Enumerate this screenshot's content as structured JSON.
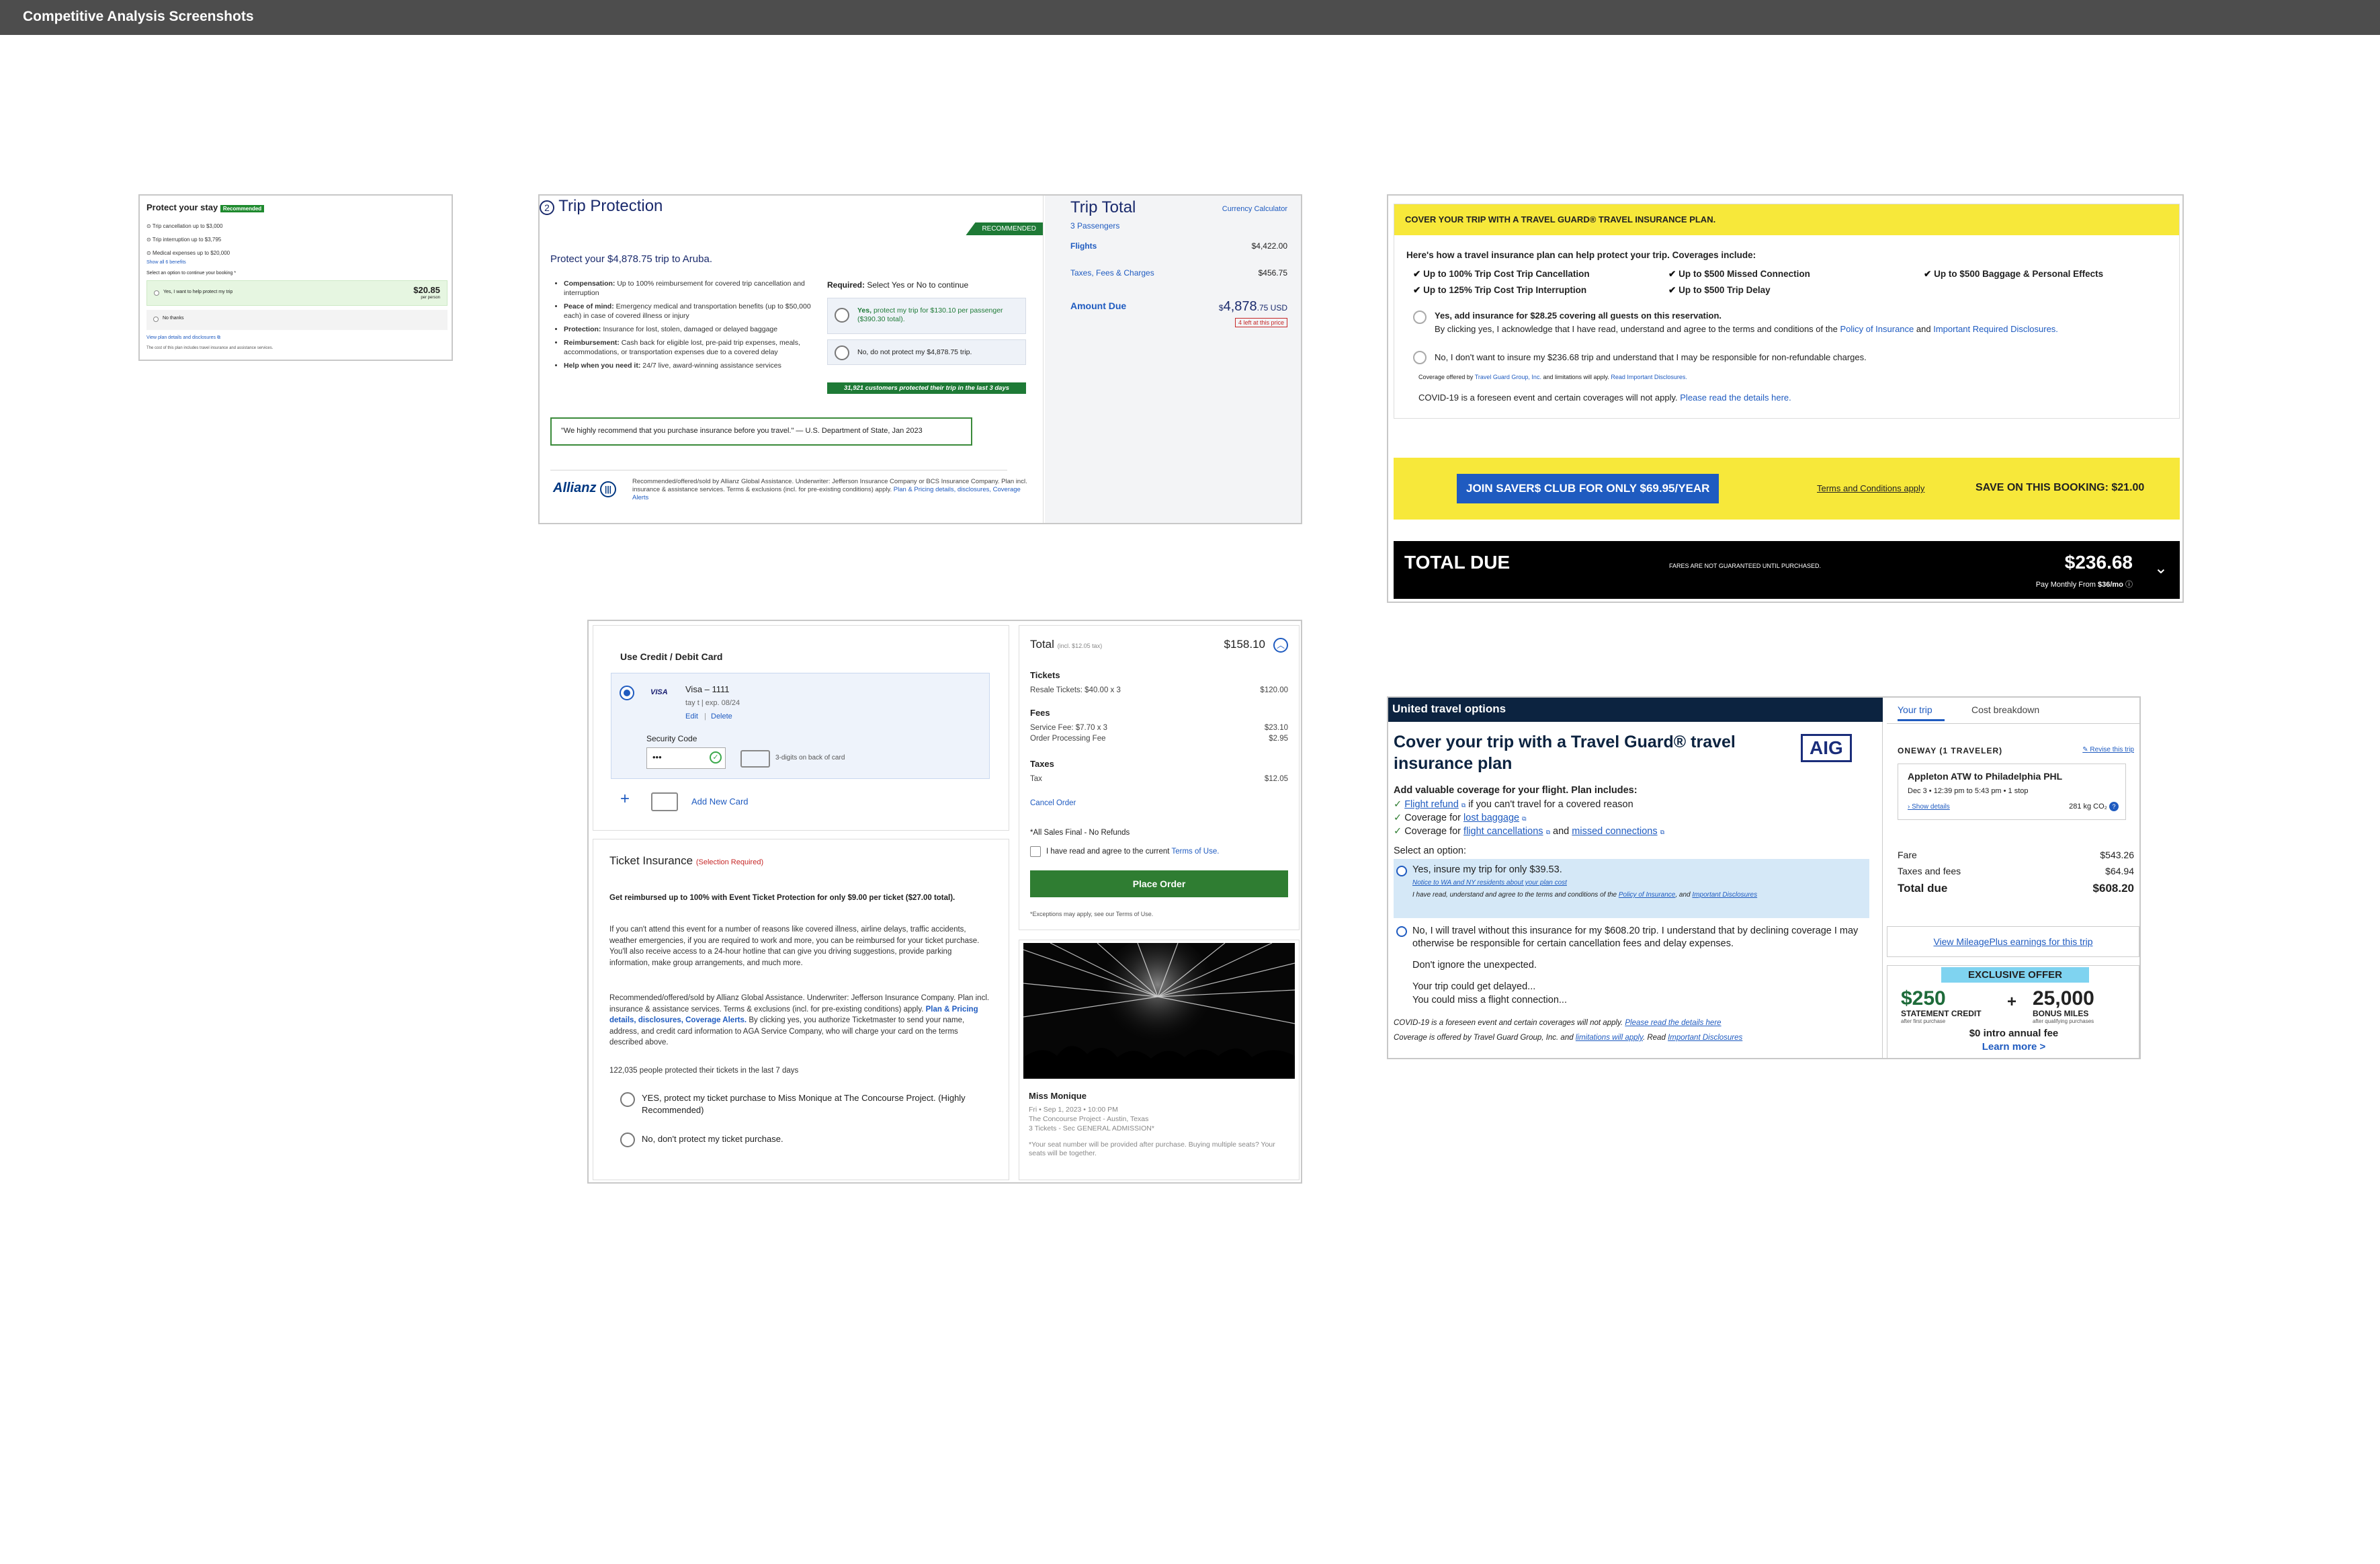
{
  "page": {
    "title": "Competitive Analysis Screenshots"
  },
  "s1": {
    "title": "Protect your stay",
    "badge": "Recommended",
    "items": [
      "Trip cancellation up to $3,000",
      "Trip interruption up to $3,795",
      "Medical expenses up to $20,000"
    ],
    "show_all": "Show all 6 benefits",
    "prompt": "Select an option to continue your booking *",
    "yes": "Yes, I want to help protect my trip",
    "price": "$20.85",
    "per": "per person",
    "no": "No thanks",
    "plan_link": "View plan details and disclosures",
    "foot": "The cost of this plan includes travel insurance and assistance services."
  },
  "s2": {
    "title": "Trip Protection",
    "badge": "RECOMMENDED",
    "heading": "Protect your $4,878.75 trip to Aruba.",
    "benefits": [
      {
        "b": "Compensation:",
        "t": " Up to 100% reimbursement for covered trip cancellation and interruption"
      },
      {
        "b": "Peace of mind:",
        "t": " Emergency medical and transportation benefits (up to $50,000 each) in case of covered illness or injury"
      },
      {
        "b": "Protection:",
        "t": " Insurance for lost, stolen, damaged or delayed baggage"
      },
      {
        "b": "Reimbursement:",
        "t": " Cash back for eligible lost, pre-paid trip expenses, meals, accommodations, or transportation expenses due to a covered delay"
      },
      {
        "b": "Help when you need it:",
        "t": " 24/7 live, award-winning assistance services"
      }
    ],
    "required_b": "Required:",
    "required": " Select Yes or No to continue",
    "yes_b": "Yes,",
    "yes": " protect my trip for $130.10 per passenger ($390.30 total).",
    "no": "No, do not protect my $4,878.75 trip.",
    "customers": "31,921 customers protected their trip in the last 3 days",
    "quote": "\"We highly recommend that you purchase insurance before you travel.\" — U.S. Department of State, Jan 2023",
    "logo": "Allianz",
    "legal": "Recommended/offered/sold by Allianz Global Assistance. Underwriter: Jefferson Insurance Company or BCS Insurance Company. Plan incl. insurance & assistance services. Terms & exclusions (incl. for pre-existing conditions) apply.",
    "legal_links": "Plan & Pricing details, disclosures, Coverage Alerts",
    "total_title": "Trip Total",
    "currency": "Currency Calculator",
    "passengers": "3 Passengers",
    "flights": "Flights",
    "flights_v": "$4,422.00",
    "taxes": "Taxes, Fees & Charges",
    "taxes_v": "$456.75",
    "amount": "Amount Due",
    "amount_sym": "$",
    "amount_v": "4,878",
    "amount_c": ".75 USD",
    "left": "4 left at this price"
  },
  "s3": {
    "banner": "COVER YOUR TRIP WITH A TRAVEL GUARD® TRAVEL INSURANCE PLAN.",
    "intro": "Here's how a travel insurance plan can help protect your trip. Coverages include:",
    "cov": [
      "Up to 100% Trip Cost Trip Cancellation",
      "Up to $500 Missed Connection",
      "Up to $500 Baggage & Personal Effects",
      "Up to 125% Trip Cost Trip Interruption",
      "Up to $500 Trip Delay"
    ],
    "yes": "Yes, add insurance for $28.25 covering all guests on this reservation.",
    "yes_sub": "By clicking yes, I acknowledge that I have read, understand and agree to the terms and conditions of the",
    "policy": "Policy of Insurance",
    "and": "and",
    "disclosures": "Important Required Disclosures.",
    "no": "No, I don't want to insure my $236.68 trip and understand that I may be responsible for non-refundable charges.",
    "offered": "Coverage offered by",
    "tg": "Travel Guard Group, Inc.",
    "offered2": "and limitations will apply.",
    "read": "Read Important Disclosures.",
    "covid": "COVID-19 is a foreseen event and certain coverages will not apply.",
    "covid_link": "Please read the details here.",
    "club_btn": "JOIN SAVER$ CLUB FOR ONLY $69.95/YEAR",
    "terms": "Terms and Conditions apply",
    "save": "SAVE ON THIS BOOKING: $21.00",
    "total_due": "TOTAL DUE",
    "fares": "FARES ARE NOT GUARANTEED UNTIL PURCHASED.",
    "total": "$236.68",
    "monthly": "Pay Monthly From",
    "monthly_v": "$36/mo"
  },
  "s4": {
    "pay_title": "Use Credit / Debit Card",
    "card_brand": "VISA",
    "card": "Visa – 1111",
    "card_holder": "tay t | exp. 08/24",
    "edit": "Edit",
    "delete": "Delete",
    "sec_label": "Security Code",
    "sec_val": "•••",
    "digits": "3-digits on back of card",
    "add_card": "Add New Card",
    "ins_title": "Ticket Insurance",
    "ins_req": "(Selection Required)",
    "ins_head": "Get reimbursed up to 100% with Event Ticket Protection for only $9.00 per ticket ($27.00 total).",
    "ins_body": "If you can't attend this event for a number of reasons like covered illness, airline delays, traffic accidents, weather emergencies, if you are required to work and more, you can be reimbursed for your ticket purchase. You'll also receive access to a 24-hour hotline that can give you driving suggestions, provide parking information, make group arrangements, and much more.",
    "ins_legal": "Recommended/offered/sold by Allianz Global Assistance. Underwriter: Jefferson Insurance Company. Plan incl. insurance & assistance services. Terms & exclusions (incl. for pre-existing conditions) apply.",
    "ins_links": "Plan & Pricing details, disclosures, Coverage Alerts.",
    "ins_legal2": "By clicking yes, you authorize Ticketmaster to send your name, address, and credit card information to AGA Service Company, who will charge your card on the terms described above.",
    "ins_count": "122,035 people protected their tickets in the last 7 days",
    "ins_yes": "YES, protect my ticket purchase to Miss Monique at The Concourse Project. (Highly Recommended)",
    "ins_no": "No, don't protect my ticket purchase.",
    "total": "Total",
    "incl": "(incl. $12.05 tax)",
    "total_v": "$158.10",
    "tickets": "Tickets",
    "resale": "Resale Tickets: $40.00 x 3",
    "resale_v": "$120.00",
    "fees": "Fees",
    "service": "Service Fee: $7.70 x 3",
    "service_v": "$23.10",
    "processing": "Order Processing Fee",
    "processing_v": "$2.95",
    "taxes": "Taxes",
    "tax": "Tax",
    "tax_v": "$12.05",
    "cancel": "Cancel Order",
    "final": "*All Sales Final - No Refunds",
    "agree": "I have read and agree to the current",
    "terms": "Terms of Use.",
    "place": "Place Order",
    "except": "*Exceptions may apply, see our Terms of Use.",
    "event": "Miss Monique",
    "date": "Fri • Sep 1, 2023 • 10:00 PM",
    "venue": "The Concourse Project - Austin, Texas",
    "seats": "3 Tickets - Sec GENERAL ADMISSION*",
    "note": "*Your seat number will be provided after purchase. Buying multiple seats? Your seats will be together."
  },
  "s5": {
    "header": "United travel options",
    "title": "Cover your trip with a Travel Guard® travel insurance plan",
    "logo": "AIG",
    "sub": "Add valuable coverage for your flight. Plan includes:",
    "l1a": "Flight refund",
    "l1b": " if you can't travel for a covered reason",
    "l2a": "Coverage for ",
    "l2b": "lost baggage",
    "l3a": "Coverage for ",
    "l3b": "flight cancellations",
    "l3c": " and ",
    "l3d": "missed connections",
    "select": "Select an option:",
    "yes": "Yes, insure my trip for only $39.53.",
    "notice": "Notice to WA and NY residents about your plan cost",
    "yes_legal": "I have read, understand and agree to the terms and conditions of the",
    "policy": "Policy of Insurance",
    "and": ", and",
    "disclosures": "Important Disclosures",
    "no": "No, I will travel without this insurance for my $608.20 trip. I understand that by declining coverage I may otherwise be responsible for certain cancellation fees and delay expenses.",
    "ignore": "Don't ignore the unexpected.",
    "delayed": "Your trip could get delayed...",
    "missed": "You could miss a flight connection...",
    "covid": "COVID-19 is a foreseen event and certain coverages will not apply.",
    "covid_link": "Please read the details here",
    "offered": "Coverage is offered by Travel Guard Group, Inc. and",
    "limitations": "limitations will apply",
    "read": ". Read",
    "important": "Important Disclosures",
    "tab1": "Your trip",
    "tab2": "Cost breakdown",
    "oneway": "ONEWAY (1 TRAVELER)",
    "revise": "Revise this trip",
    "route": "Appleton ATW to Philadelphia PHL",
    "when": "Dec 3 • 12:39 pm to 5:43 pm • 1 stop",
    "details": "Show details",
    "co2": "281 kg CO₂",
    "fare": "Fare",
    "fare_v": "$543.26",
    "taxes": "Taxes and fees",
    "taxes_v": "$64.94",
    "total": "Total due",
    "total_v": "$608.20",
    "mileage": "View MileagePlus earnings for this trip",
    "exclusive": "EXCLUSIVE OFFER",
    "credit": "$250",
    "credit_l": "STATEMENT CREDIT",
    "credit_s": "after first purchase",
    "plus": "+",
    "miles": "25,000",
    "miles_l": "BONUS MILES",
    "miles_s": "after qualifying purchases",
    "annual": "$0 intro annual fee",
    "learn": "Learn more >"
  }
}
